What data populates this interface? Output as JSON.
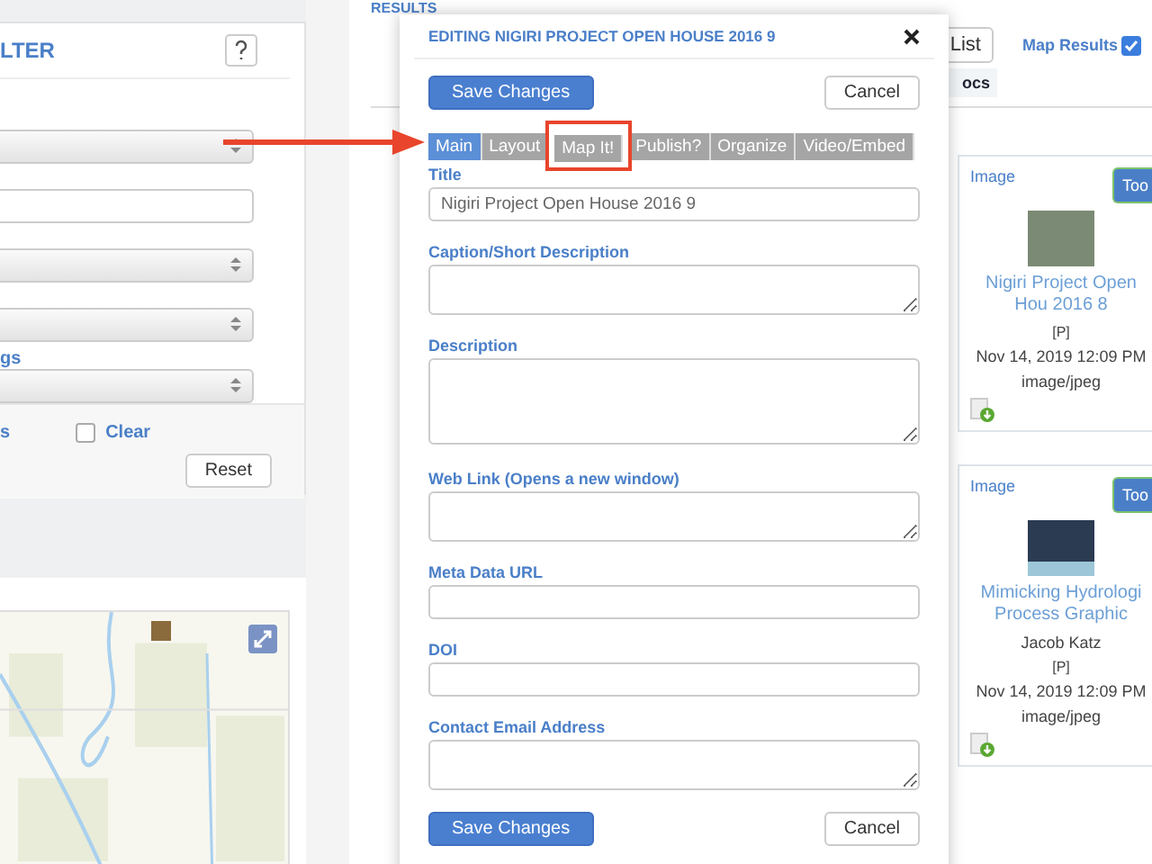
{
  "filter_panel": {
    "title": "LTER",
    "link_label": "gs",
    "footer_text": "s",
    "clear_checkbox": {
      "label": "Clear",
      "checked": false
    },
    "reset_button": "Reset"
  },
  "results": {
    "heading": "RESULTS",
    "list_button": "List",
    "map_results": {
      "label": "Map Results",
      "checked": true
    },
    "tab_label": "ocs",
    "cards": [
      {
        "type": "Image",
        "tool_button": "Too",
        "title": "Nigiri Project Open Hou 2016 8",
        "flag": "[P]",
        "date": "Nov 14, 2019 12:09 PM",
        "mime": "image/jpeg"
      },
      {
        "type": "Image",
        "tool_button": "Too",
        "title": "Mimicking Hydrologi Process Graphic",
        "author": "Jacob Katz",
        "flag": "[P]",
        "date": "Nov 14, 2019 12:09 PM",
        "mime": "image/jpeg"
      }
    ]
  },
  "modal": {
    "title": "EDITING NIGIRI PROJECT OPEN HOUSE 2016 9",
    "save_button": "Save Changes",
    "cancel_button": "Cancel",
    "tabs": [
      {
        "label": "Main",
        "selected": true,
        "highlighted": false
      },
      {
        "label": "Layout",
        "selected": false,
        "highlighted": false
      },
      {
        "label": "Map It!",
        "selected": false,
        "highlighted": true
      },
      {
        "label": "Publish?",
        "selected": false,
        "highlighted": false
      },
      {
        "label": "Organize",
        "selected": false,
        "highlighted": false
      },
      {
        "label": "Video/Embed",
        "selected": false,
        "highlighted": false
      }
    ],
    "fields": [
      {
        "label": "Title",
        "kind": "input",
        "value": "Nigiri Project Open House 2016 9"
      },
      {
        "label": "Caption/Short Description",
        "kind": "textarea"
      },
      {
        "label": "Description",
        "kind": "tall"
      },
      {
        "label": "Web Link (Opens a new window)",
        "kind": "textarea"
      },
      {
        "label": "Meta Data URL",
        "kind": "input"
      },
      {
        "label": "DOI",
        "kind": "input"
      },
      {
        "label": "Contact Email Address",
        "kind": "textarea"
      }
    ],
    "bottom_save_button": "Save Changes",
    "bottom_cancel_button": "Cancel"
  }
}
